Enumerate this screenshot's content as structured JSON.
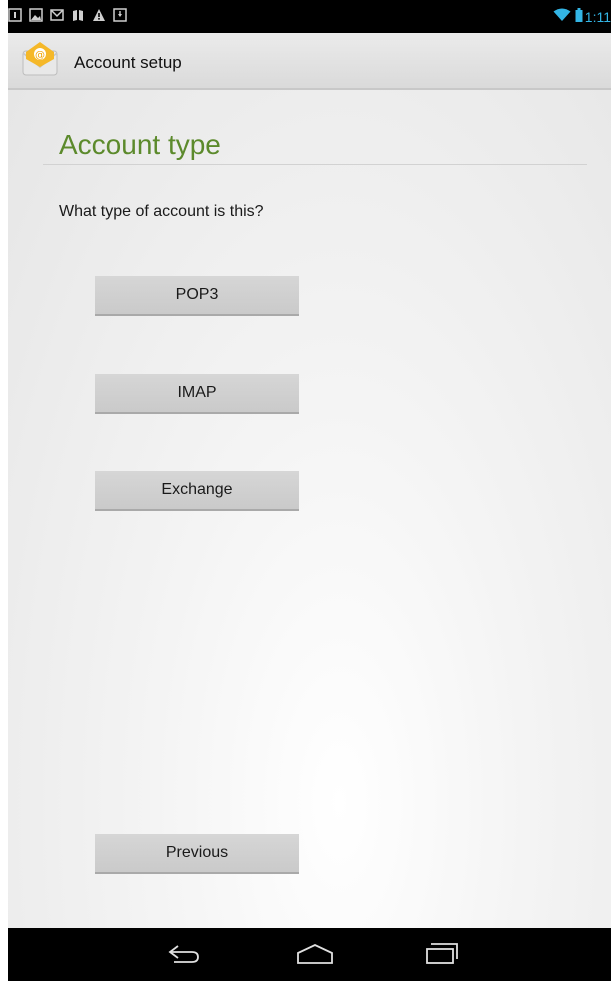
{
  "status_bar": {
    "time": "1:11",
    "notification_icons": [
      "calendar-icon",
      "photo-icon",
      "gmail-icon",
      "books-icon",
      "warning-icon",
      "download-icon"
    ],
    "system_icons": [
      "wifi-icon",
      "battery-icon"
    ],
    "accent_color": "#33b5e5"
  },
  "action_bar": {
    "icon": "email-app-icon",
    "title": "Account setup"
  },
  "main": {
    "title": "Account type",
    "title_color": "#5c8a2c",
    "question": "What type of account is this?",
    "options": [
      {
        "label": "POP3"
      },
      {
        "label": "IMAP"
      },
      {
        "label": "Exchange"
      }
    ],
    "previous_label": "Previous"
  },
  "nav_bar": {
    "buttons": [
      "back-icon",
      "home-icon",
      "recents-icon"
    ]
  }
}
